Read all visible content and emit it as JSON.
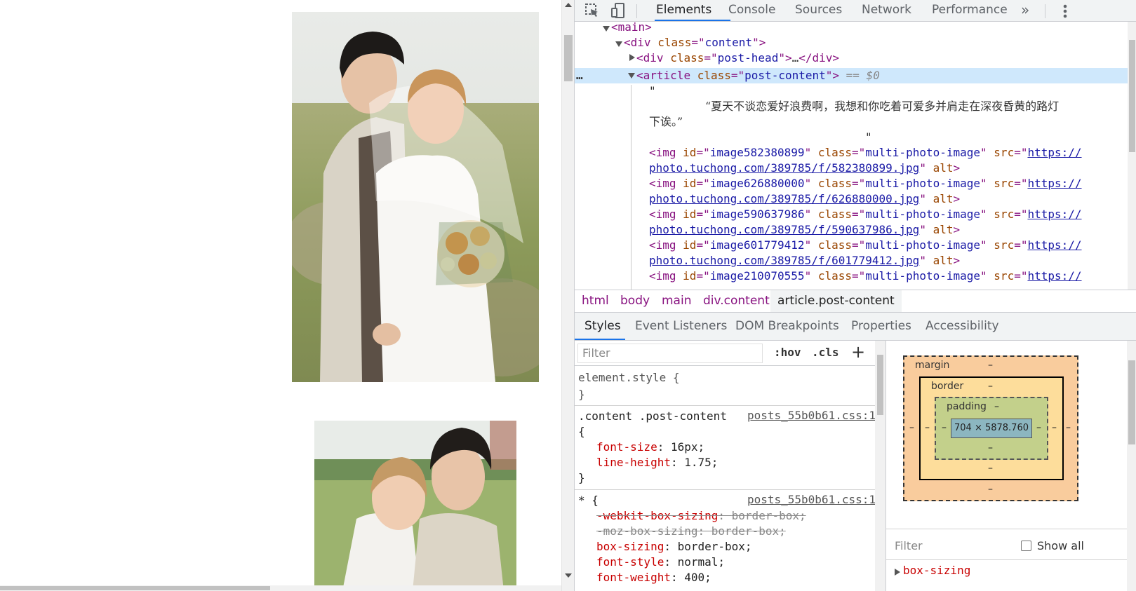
{
  "devtools": {
    "tabs": [
      "Elements",
      "Console",
      "Sources",
      "Network",
      "Performance"
    ],
    "more_tabs": "»",
    "elements_tree": {
      "main_tag": "<main>",
      "content_div": {
        "tag": "div",
        "attr": "class",
        "value": "content"
      },
      "post_head": {
        "tag": "div",
        "attr": "class",
        "value": "post-head",
        "ellipsis": "…"
      },
      "article": {
        "tag": "article",
        "attr": "class",
        "value": "post-content",
        "marker": "== $0"
      },
      "gutter_dots": "…",
      "quote_open": "\"",
      "text_line1": "“夏天不谈恋爱好浪费啊，我想和你吃着可爱多并肩走在深夜昏黄的路灯",
      "text_line2": "下诶。”",
      "quote_close": "\"",
      "img_attr_id": "id",
      "img_attr_class": "class",
      "img_class_value": "multi-photo-image",
      "img_attr_src": "src",
      "img_attr_alt": "alt",
      "images": [
        {
          "id": "image582380899",
          "src_a": "https://",
          "src_b": "photo.tuchong.com/389785/f/582380899.jpg"
        },
        {
          "id": "image626880000",
          "src_a": "https://",
          "src_b": "photo.tuchong.com/389785/f/626880000.jpg"
        },
        {
          "id": "image590637986",
          "src_a": "https://",
          "src_b": "photo.tuchong.com/389785/f/590637986.jpg"
        },
        {
          "id": "image601779412",
          "src_a": "https://",
          "src_b": "photo.tuchong.com/389785/f/601779412.jpg"
        },
        {
          "id": "image210070555",
          "src_a": "https://",
          "src_b": ""
        }
      ]
    },
    "breadcrumbs": [
      "html",
      "body",
      "main",
      "div.content",
      "article.post-content"
    ],
    "sub_tabs": [
      "Styles",
      "Event Listeners",
      "DOM Breakpoints",
      "Properties",
      "Accessibility"
    ],
    "styles": {
      "filter_placeholder": "Filter",
      "hov": ":hov",
      "cls": ".cls",
      "plus": "+",
      "rules": [
        {
          "selector": "element.style {",
          "close": "}",
          "source": "",
          "props": []
        },
        {
          "selector": ".content .post-content",
          "open": "{",
          "close": "}",
          "source": "posts_55b0b61.css:1",
          "props": [
            {
              "name": "font-size",
              "value": "16px;"
            },
            {
              "name": "line-height",
              "value": "1.75;"
            }
          ]
        },
        {
          "selector": "* {",
          "source": "posts_55b0b61.css:1",
          "props": [
            {
              "name": "-webkit-box-sizing",
              "value": "border-box;",
              "struck": true
            },
            {
              "name": "-moz-box-sizing",
              "value": "border-box;",
              "struck": true
            },
            {
              "name": "box-sizing",
              "value": "border-box;"
            },
            {
              "name": "font-style",
              "value": "normal;"
            },
            {
              "name": "font-weight",
              "value": "400;"
            }
          ]
        }
      ]
    },
    "box_model": {
      "margin": "margin",
      "border": "border",
      "padding": "padding",
      "dash": "–",
      "content_size": "704 × 5878.760"
    },
    "computed": {
      "filter_placeholder": "Filter",
      "show_all": "Show all",
      "first_property": "box-sizing"
    },
    "colors": {
      "accent": "#1a73e8",
      "tag": "#881280",
      "attr": "#994500",
      "value": "#1a1aa6",
      "margin": "#f9cc9d",
      "border": "#fddd9b",
      "padding": "#c3d08b",
      "content": "#8cb6c0"
    }
  }
}
